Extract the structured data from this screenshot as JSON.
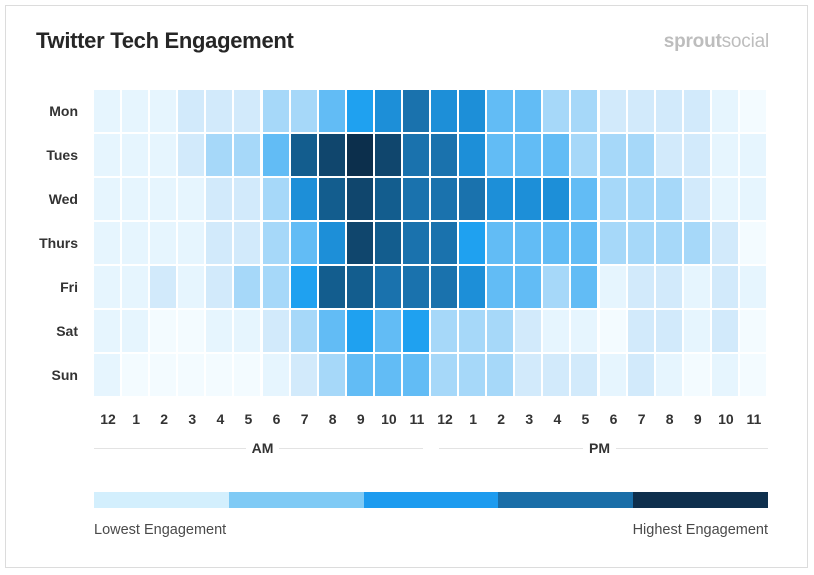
{
  "card": {
    "title": "Twitter Tech Engagement",
    "brand_bold": "sprout",
    "brand_light": "social"
  },
  "legend": {
    "low_label": "Lowest Engagement",
    "high_label": "Highest Engagement",
    "colors": [
      "#d3effd",
      "#7fcaf5",
      "#1d9bef",
      "#1a6ea8",
      "#0e2f4d"
    ]
  },
  "chart_data": {
    "type": "heatmap",
    "title": "Twitter Tech Engagement",
    "rows": [
      "Mon",
      "Tues",
      "Wed",
      "Thurs",
      "Fri",
      "Sat",
      "Sun"
    ],
    "columns": [
      "12",
      "1",
      "2",
      "3",
      "4",
      "5",
      "6",
      "7",
      "8",
      "9",
      "10",
      "11",
      "12",
      "1",
      "2",
      "3",
      "4",
      "5",
      "6",
      "7",
      "8",
      "9",
      "10",
      "11"
    ],
    "column_groups": [
      {
        "label": "AM",
        "span": 12
      },
      {
        "label": "PM",
        "span": 12
      }
    ],
    "value_scale": "relative engagement level 0 (lowest) to 9 (highest)",
    "values": [
      [
        1,
        1,
        1,
        2,
        2,
        2,
        3,
        3,
        4,
        5,
        6,
        7,
        6,
        6,
        4,
        4,
        3,
        3,
        2,
        2,
        2,
        2,
        1,
        0
      ],
      [
        1,
        1,
        1,
        2,
        3,
        3,
        4,
        8,
        8.5,
        9,
        8.5,
        7,
        7,
        6,
        4,
        4,
        4,
        3,
        3,
        3,
        2,
        2,
        1,
        1
      ],
      [
        1,
        1,
        1,
        1,
        2,
        2,
        3,
        6,
        8,
        8.5,
        8,
        7,
        7,
        7,
        6,
        6,
        6,
        4,
        3,
        3,
        3,
        2,
        1,
        1
      ],
      [
        1,
        1,
        1,
        1,
        2,
        2,
        3,
        4,
        6,
        8.5,
        8,
        7,
        7,
        5,
        4,
        4,
        4,
        4,
        3,
        3,
        3,
        3,
        2,
        0
      ],
      [
        1,
        1,
        2,
        1,
        2,
        3,
        3,
        5,
        8,
        8,
        7,
        7,
        7,
        6,
        4,
        4,
        3,
        4,
        1,
        2,
        2,
        1,
        2,
        1
      ],
      [
        1,
        1,
        0,
        0,
        1,
        1,
        2,
        3,
        4,
        5,
        4,
        5,
        3,
        3,
        3,
        2,
        1,
        1,
        0,
        2,
        2,
        1,
        2,
        0
      ],
      [
        1,
        0,
        0,
        0,
        0,
        0,
        1,
        2,
        3,
        4,
        4,
        4,
        3,
        3,
        3,
        2,
        2,
        2,
        1,
        2,
        1,
        0,
        1,
        0
      ]
    ],
    "color_scale": [
      "#f3fbff",
      "#e6f5fe",
      "#d2eafb",
      "#a6d8f9",
      "#62bcf5",
      "#1fa1f0",
      "#1d8fd8",
      "#1a72ad",
      "#135d8e",
      "#0c2f4c"
    ],
    "legend": {
      "low": "Lowest Engagement",
      "high": "Highest Engagement",
      "placement": "bottom"
    }
  }
}
